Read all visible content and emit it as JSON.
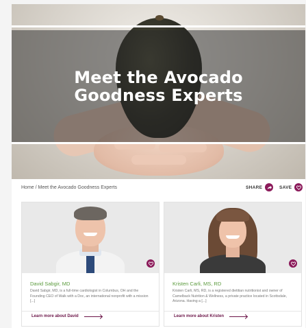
{
  "hero": {
    "title_line1": "Meet the Avocado",
    "title_line2": "Goodness Experts"
  },
  "breadcrumb": {
    "home": "Home",
    "separator": " / ",
    "current": "Meet the Avocado Goodness Experts"
  },
  "actions": {
    "share_label": "SHARE",
    "save_label": "SAVE"
  },
  "colors": {
    "accent": "#8b1a5a",
    "name_green": "#5a9a3c"
  },
  "experts": [
    {
      "name": "David Sabgir, MD",
      "description": "David Sabgir, MD, is a full-time cardiologist in Columbus, OH and the Founding CEO of Walk with a Doc, an international nonprofit with a mission [...]",
      "link_label": "Learn more about David"
    },
    {
      "name": "Kristen Carli, MS, RD",
      "description": "Kristen Carli, MS, RD, is a registered dietitian nutritionist and owner of Camelback Nutrition & Wellness, a private practice located in Scottsdale, Arizona. Having a [...]",
      "link_label": "Learn more about Kristen"
    }
  ]
}
